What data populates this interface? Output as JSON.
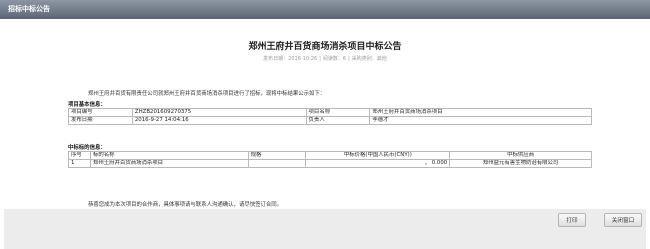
{
  "window": {
    "title": "招标中标公告"
  },
  "doc": {
    "title": "郑州王府井百货商场消杀项目中标公告",
    "meta_date": "发布日期：2016-10-26",
    "meta_sep1": "|",
    "meta_views": "阅读数：6",
    "meta_sep2": "|",
    "meta_category": "采购类别：其他",
    "intro": "郑州王府井百货有限责任公司就郑州王府井百货商场消杀项目进行了招标，现将中标结果公示如下：",
    "section1_title": "项目基本信息：",
    "basic": [
      [
        "项目编号",
        "ZHZB201609270375",
        "项目名称",
        "郑州王府井百货商场消杀项目"
      ],
      [
        "发布日期",
        "2016-9-27 14:04:16",
        "负责人",
        "李德才"
      ]
    ],
    "section2_title": "中标标的信息：",
    "award_headers": [
      "序号",
      "标的名称",
      "规格",
      "中标价格(中国人民币(CNY))",
      "中标供应商"
    ],
    "award_rows": [
      [
        "1",
        "郑州王府井百货商场消杀项目",
        "",
        "， 0.000",
        "郑州益元有害生物防治有限公司"
      ]
    ],
    "closing": "恭喜您成为本次项目的合作商，具体事项请与联系人沟通确认，请尽快签订合同。"
  },
  "footer": {
    "print_label": "打印",
    "close_label": "关闭窗口"
  }
}
